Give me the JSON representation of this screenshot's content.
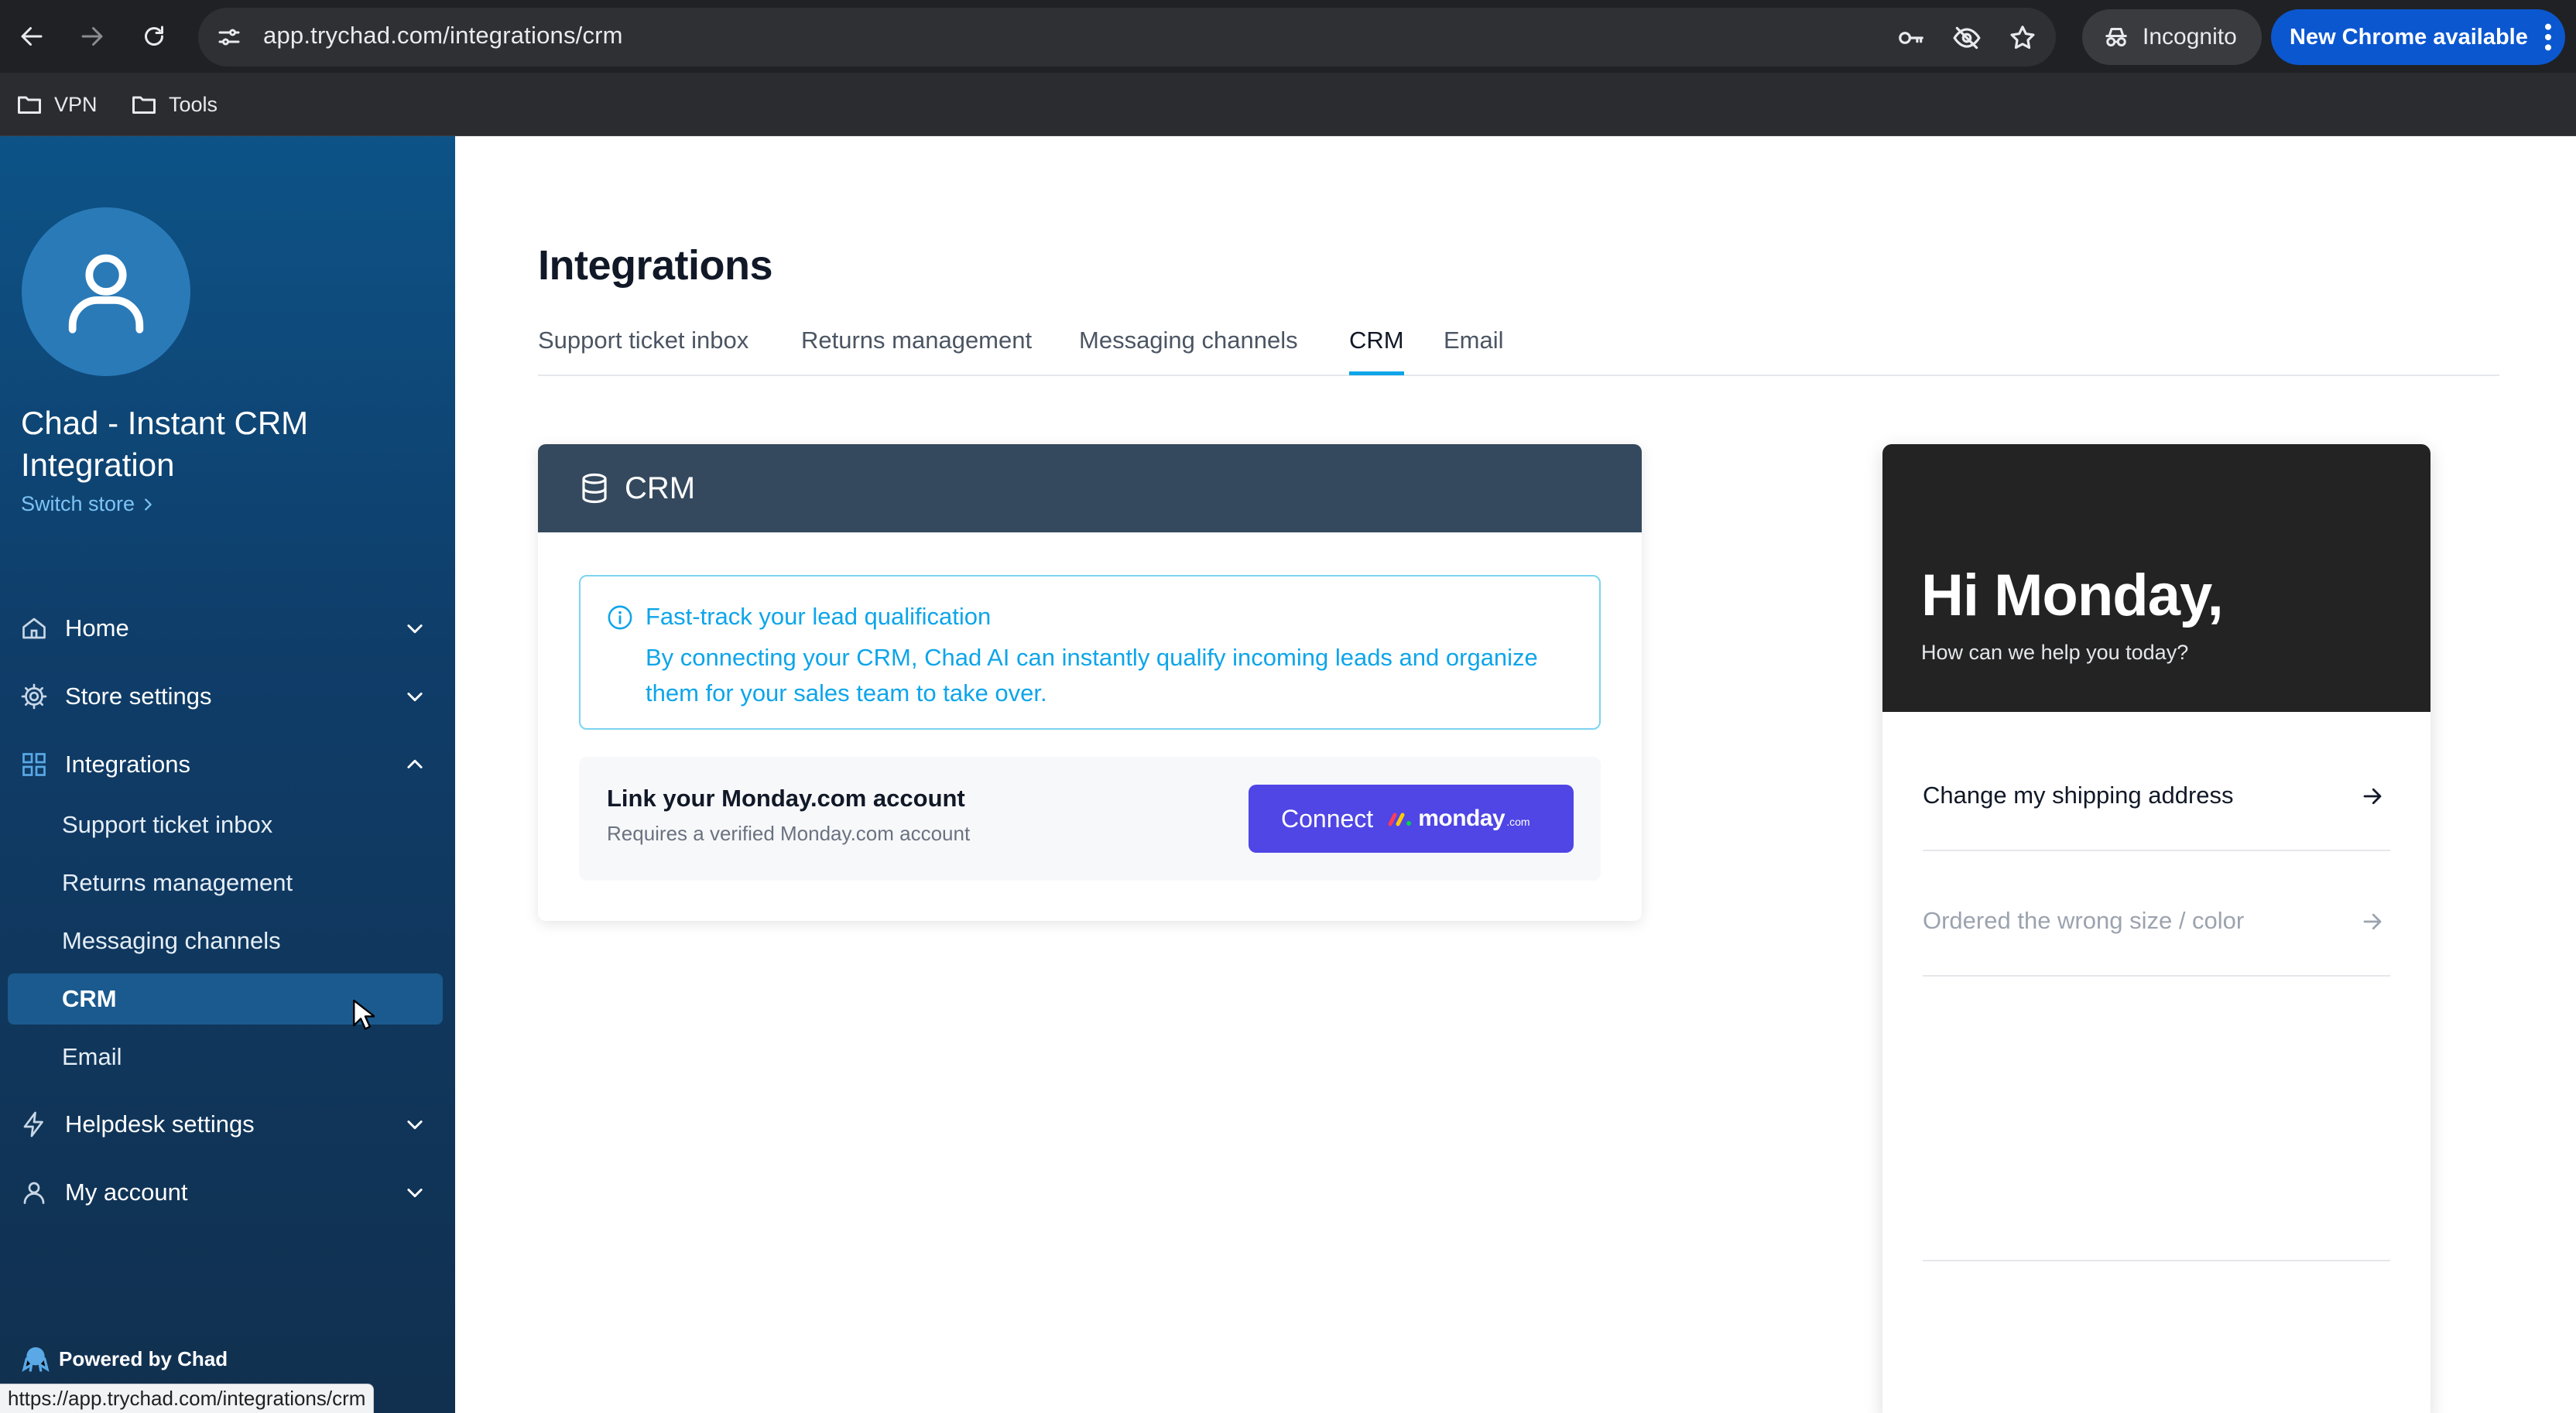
{
  "browser": {
    "url": "app.trychad.com/integrations/crm",
    "incognito_label": "Incognito",
    "new_chrome_label": "New Chrome available",
    "bookmarks": [
      {
        "label": "VPN"
      },
      {
        "label": "Tools"
      }
    ],
    "status_url": "https://app.trychad.com/integrations/crm"
  },
  "sidebar": {
    "store_name": "Chad - Instant CRM Integration",
    "switch_store": "Switch store",
    "nav": [
      {
        "label": "Home",
        "icon": "home-icon",
        "expanded": false
      },
      {
        "label": "Store settings",
        "icon": "gear-icon",
        "expanded": false
      },
      {
        "label": "Integrations",
        "icon": "grid-icon",
        "expanded": true
      },
      {
        "label": "Helpdesk settings",
        "icon": "lightning-icon",
        "expanded": false
      },
      {
        "label": "My account",
        "icon": "user-icon",
        "expanded": false
      }
    ],
    "integrations_sub": [
      {
        "label": "Support ticket inbox"
      },
      {
        "label": "Returns management"
      },
      {
        "label": "Messaging channels"
      },
      {
        "label": "CRM",
        "active": true
      },
      {
        "label": "Email"
      }
    ],
    "powered_by": "Powered by Chad"
  },
  "main": {
    "title": "Integrations",
    "tabs": [
      {
        "label": "Support ticket inbox"
      },
      {
        "label": "Returns management"
      },
      {
        "label": "Messaging channels"
      },
      {
        "label": "CRM",
        "active": true
      },
      {
        "label": "Email"
      }
    ],
    "active_tab_color": "#0ea5e9",
    "crm_card": {
      "title": "CRM",
      "info_title": "Fast-track your lead qualification",
      "info_body": "By connecting your CRM, Chad AI can instantly qualify incoming leads and organize them for your sales team to take over.",
      "link_title": "Link your Monday.com account",
      "link_subtitle": "Requires a verified Monday.com account",
      "connect_label": "Connect",
      "monday_word": "monday",
      "monday_suffix": ".com",
      "button_color": "#4f46e5"
    }
  },
  "widget": {
    "greeting": "Hi Monday,",
    "subtitle": "How can we help you today?",
    "options": [
      {
        "label": "Change my shipping address"
      },
      {
        "label": "Ordered the wrong size / color"
      }
    ]
  }
}
